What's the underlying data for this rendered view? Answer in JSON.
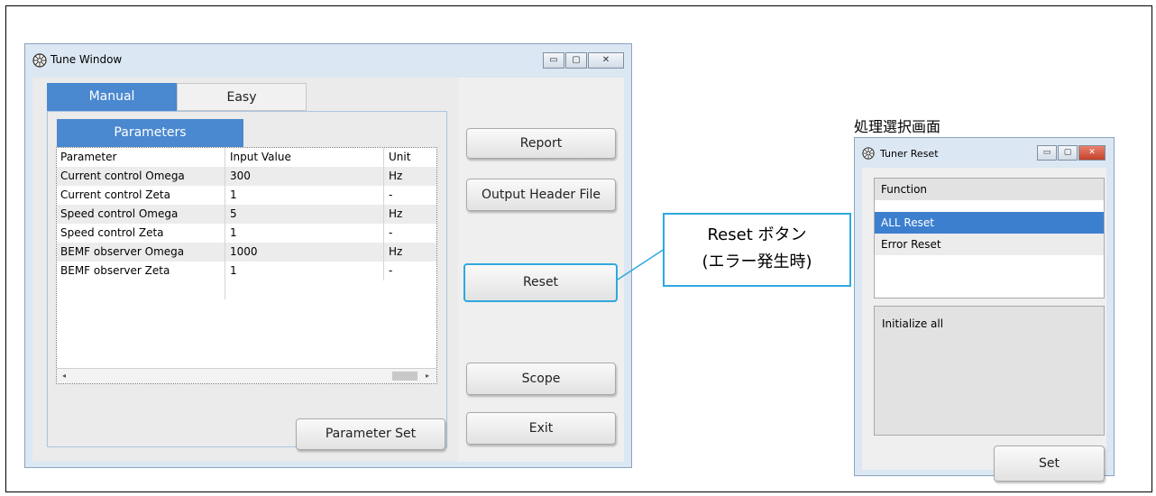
{
  "tune_window": {
    "title": "Tune Window",
    "window_buttons": {
      "minimize": "▭",
      "maximize": "▢",
      "close": "✕"
    },
    "tabs": [
      {
        "label": "Manual",
        "active": true
      },
      {
        "label": "Easy",
        "active": false
      }
    ],
    "subtab": "Parameters",
    "grid": {
      "columns": [
        "Parameter",
        "Input Value",
        "Unit"
      ],
      "rows": [
        [
          "Current control Omega",
          "300",
          "Hz"
        ],
        [
          "Current control Zeta",
          "1",
          "-"
        ],
        [
          "Speed control Omega",
          "5",
          "Hz"
        ],
        [
          "Speed control Zeta",
          "1",
          "-"
        ],
        [
          "BEMF observer Omega",
          "1000",
          "Hz"
        ],
        [
          "BEMF observer Zeta",
          "1",
          "-"
        ]
      ]
    },
    "parameter_set_label": "Parameter Set",
    "side_buttons": {
      "report": "Report",
      "output_header": "Output Header File",
      "reset": "Reset",
      "scope": "Scope",
      "exit": "Exit"
    }
  },
  "callout": {
    "line1": "Reset ボタン",
    "line2": "(エラー発生時)"
  },
  "screen_label": "処理選択画面",
  "tuner_reset": {
    "title": "Tuner Reset",
    "list_header": "Function",
    "items": [
      {
        "label": "ALL Reset",
        "selected": true
      },
      {
        "label": "Error Reset",
        "selected": false
      }
    ],
    "description": "Initialize all",
    "set_label": "Set"
  },
  "colors": {
    "accent": "#4a88d0",
    "highlight": "#2ea8e0",
    "window_frame": "#dbe7f3"
  }
}
